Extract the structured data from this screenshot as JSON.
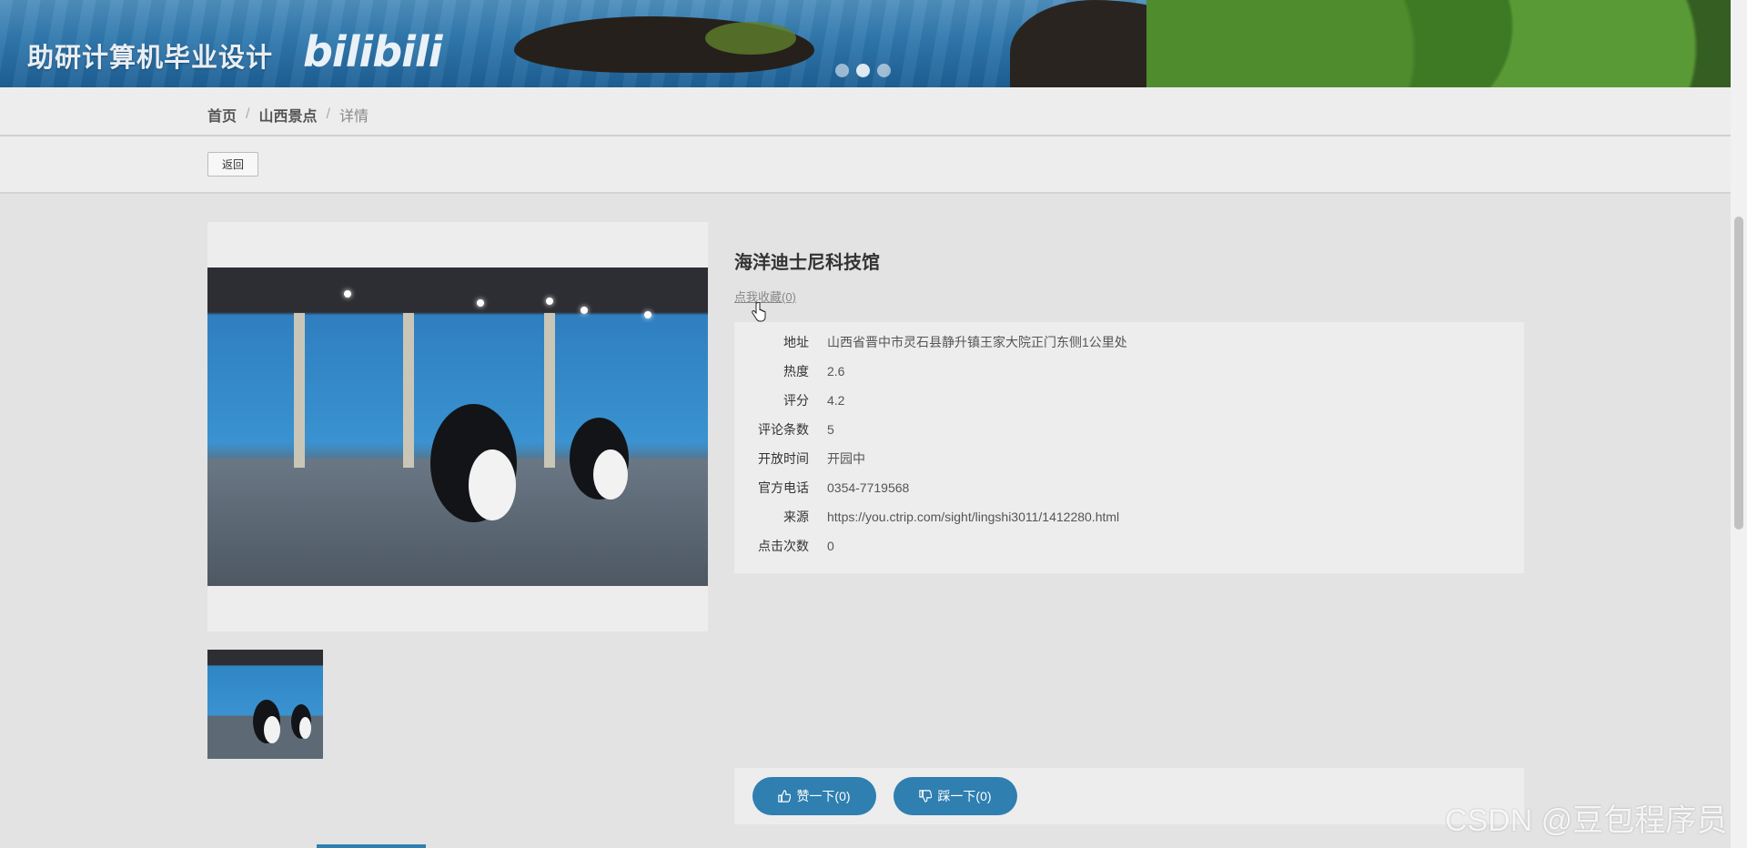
{
  "banner": {
    "title": "助研计算机毕业设计",
    "logo": "bilibili",
    "carousel_dots": 3,
    "active_dot": 2
  },
  "breadcrumb": {
    "items": [
      "首页",
      "山西景点",
      "详情"
    ],
    "separator": "/"
  },
  "toolbar": {
    "back_label": "返回"
  },
  "detail": {
    "title": "海洋迪士尼科技馆",
    "favorite_label": "点我收藏(0)",
    "fields": [
      {
        "label": "地址",
        "value": "山西省晋中市灵石县静升镇王家大院正门东侧1公里处"
      },
      {
        "label": "热度",
        "value": "2.6"
      },
      {
        "label": "评分",
        "value": "4.2"
      },
      {
        "label": "评论条数",
        "value": "5"
      },
      {
        "label": "开放时间",
        "value": "开园中"
      },
      {
        "label": "官方电话",
        "value": "0354-7719568"
      },
      {
        "label": "来源",
        "value": "https://you.ctrip.com/sight/lingshi3011/1412280.html"
      },
      {
        "label": "点击次数",
        "value": "0"
      }
    ]
  },
  "votes": {
    "like_label": "赞一下(0)",
    "dislike_label": "踩一下(0)"
  },
  "watermark": "CSDN @豆包程序员",
  "colors": {
    "accent": "#2f7fb0",
    "background": "#e3e3e3",
    "panel": "#ededed"
  }
}
